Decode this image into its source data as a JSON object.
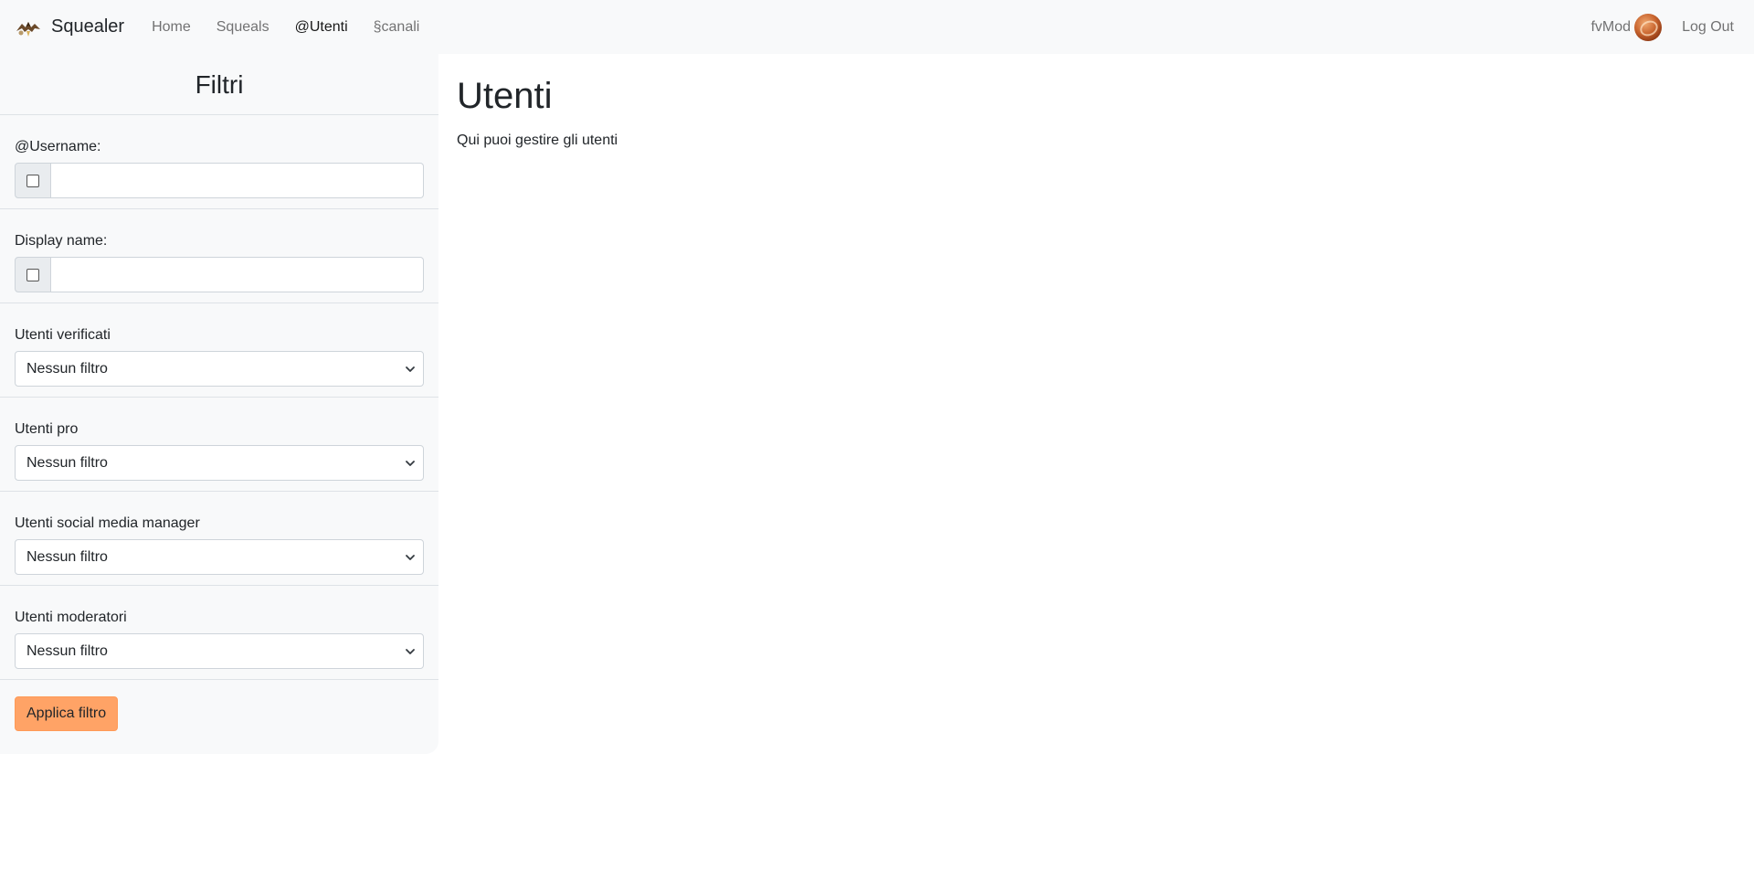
{
  "navbar": {
    "brand": "Squealer",
    "links": [
      {
        "label": "Home",
        "active": false
      },
      {
        "label": "Squeals",
        "active": false
      },
      {
        "label": "@Utenti",
        "active": true
      },
      {
        "label": "§canali",
        "active": false
      }
    ],
    "username": "fvMod",
    "logout_label": "Log Out"
  },
  "sidebar": {
    "title": "Filtri",
    "filters": {
      "username": {
        "label": "@Username:",
        "value": ""
      },
      "display_name": {
        "label": "Display name:",
        "value": ""
      },
      "verified": {
        "label": "Utenti verificati",
        "selected": "Nessun filtro"
      },
      "pro": {
        "label": "Utenti pro",
        "selected": "Nessun filtro"
      },
      "smm": {
        "label": "Utenti social media manager",
        "selected": "Nessun filtro"
      },
      "moderators": {
        "label": "Utenti moderatori",
        "selected": "Nessun filtro"
      }
    },
    "apply_label": "Applica filtro"
  },
  "main": {
    "title": "Utenti",
    "subtitle": "Qui puoi gestire gli utenti"
  },
  "colors": {
    "navbar_bg": "#f8f9fa",
    "sidebar_bg": "#f8f9fa",
    "apply_button": "#ffa366"
  },
  "icons": {
    "brand": "eagle-logo-icon",
    "select": "chevron-down-icon",
    "avatar": "user-avatar"
  }
}
